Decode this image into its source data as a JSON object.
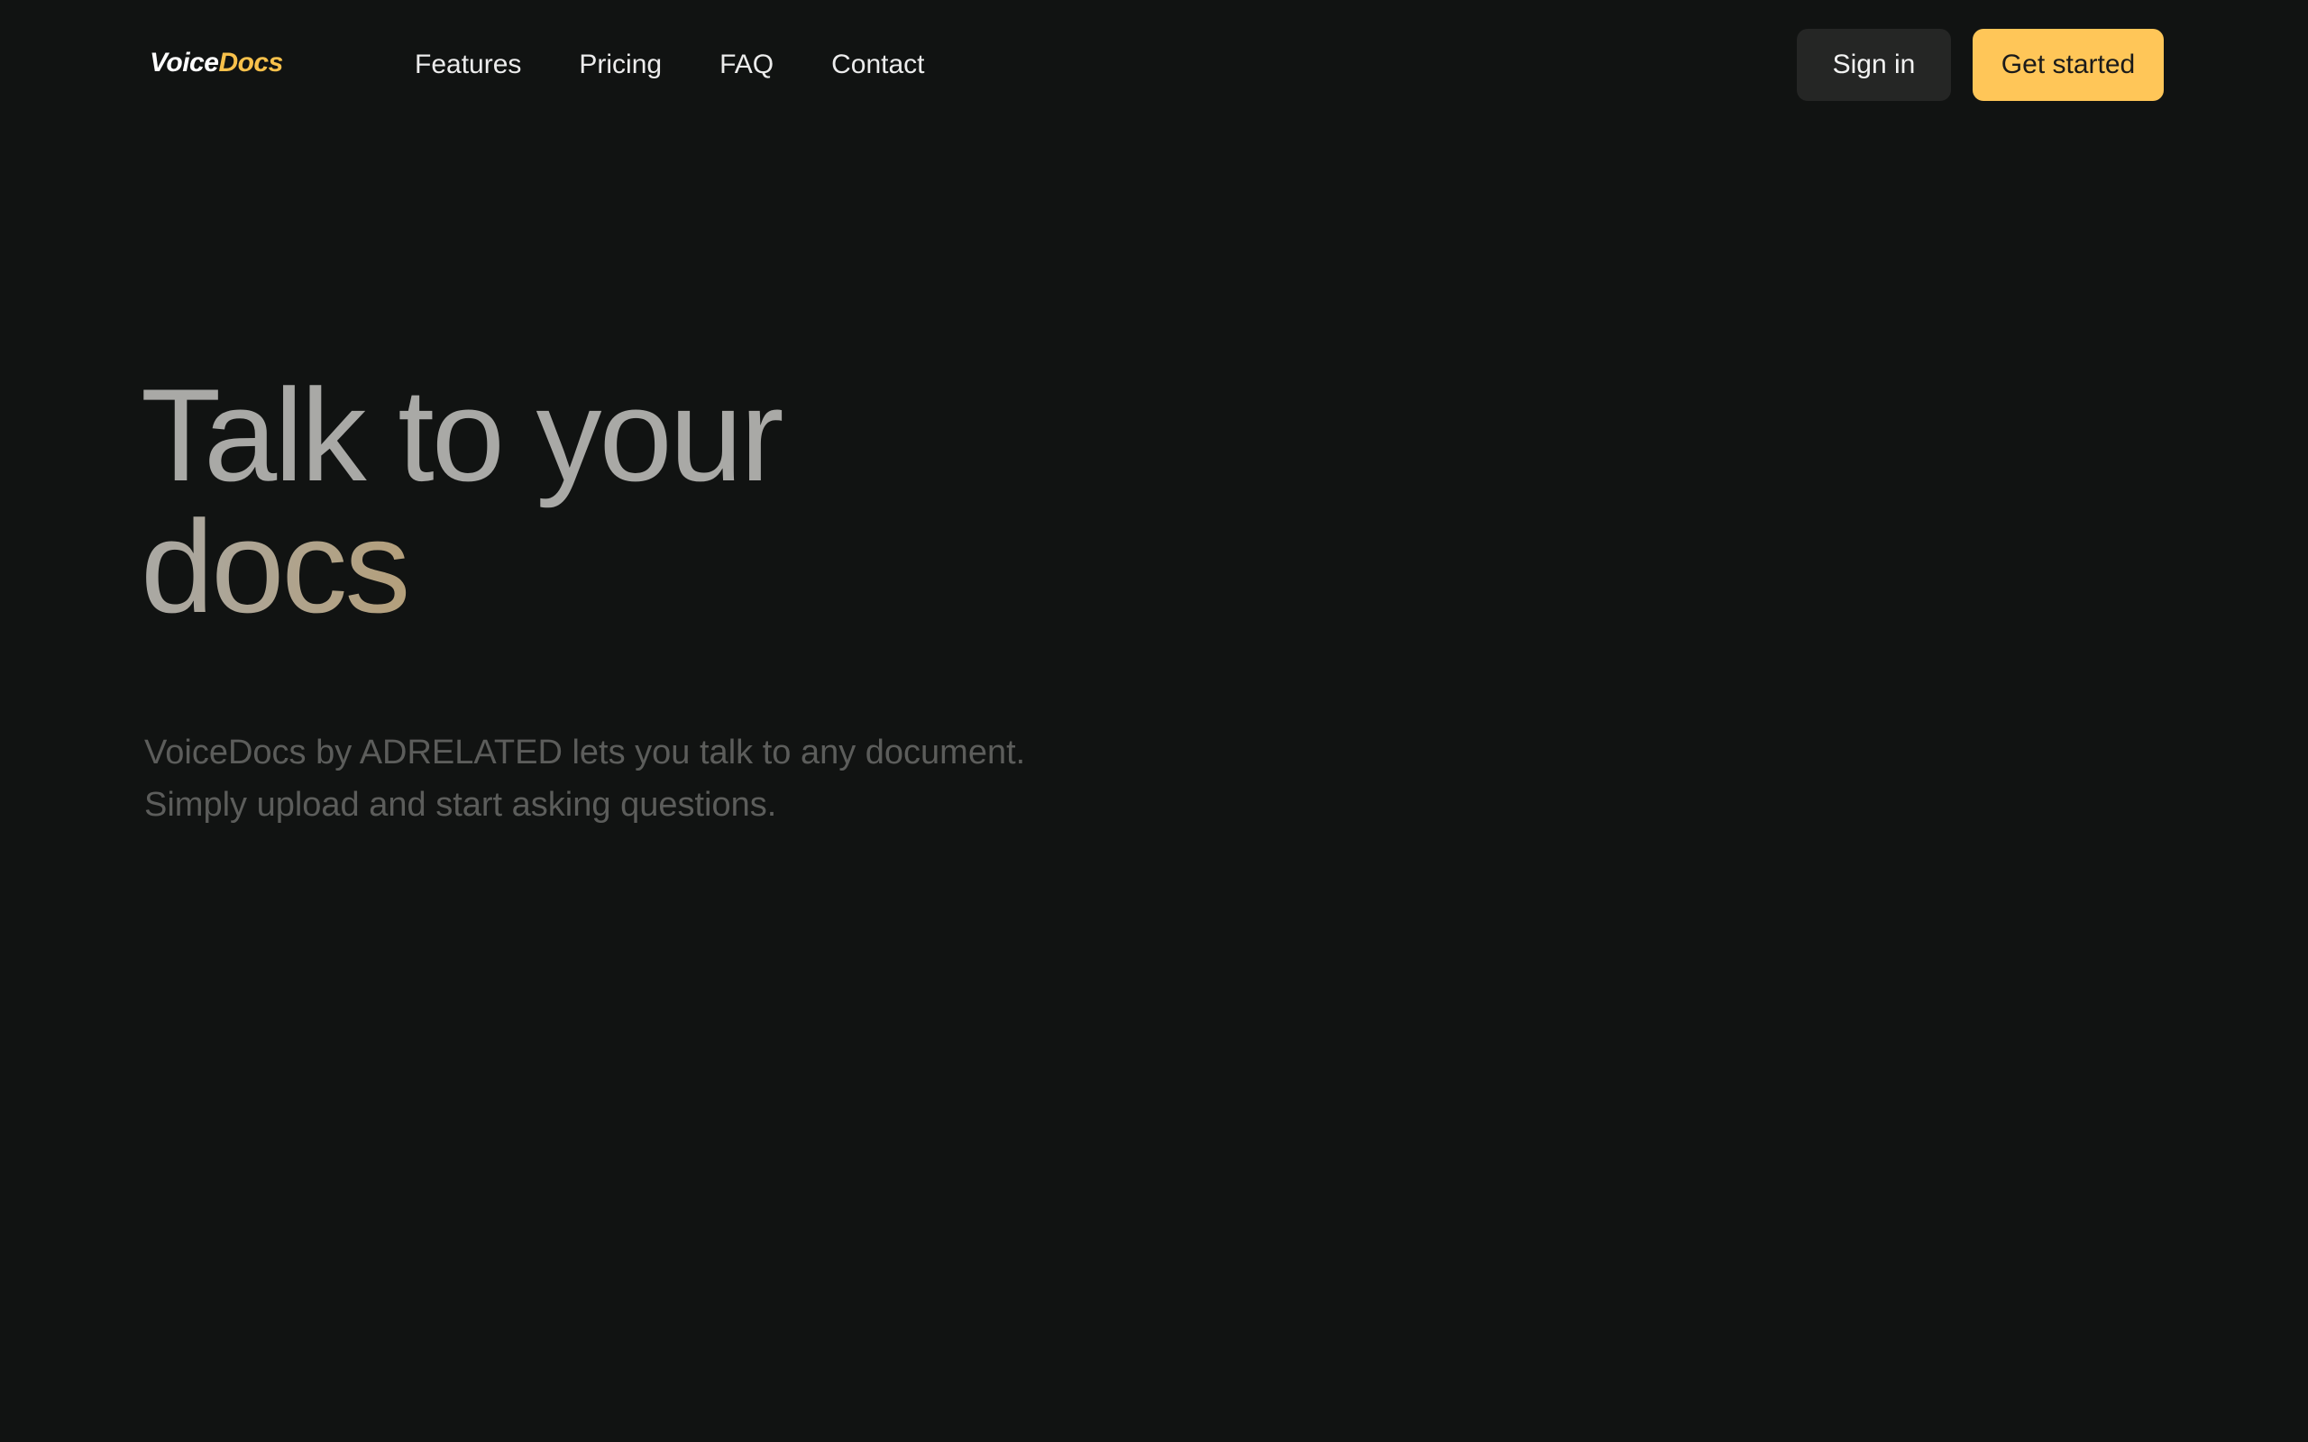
{
  "brand": {
    "name_part1": "Voice",
    "name_part2": "Docs",
    "accent_color": "#f8c14b"
  },
  "nav": {
    "links": [
      {
        "label": "Features"
      },
      {
        "label": "Pricing"
      },
      {
        "label": "FAQ"
      },
      {
        "label": "Contact"
      }
    ],
    "sign_in_label": "Sign in",
    "get_started_label": "Get started"
  },
  "hero": {
    "title_line1": "Talk to your",
    "title_line2": "docs",
    "subtitle_line1": "VoiceDocs by ADRELATED lets you talk to any document.",
    "subtitle_line2": "Simply upload and start asking questions."
  },
  "colors": {
    "background": "#111312",
    "primary_button": "#ffc658",
    "secondary_button": "#252625"
  }
}
